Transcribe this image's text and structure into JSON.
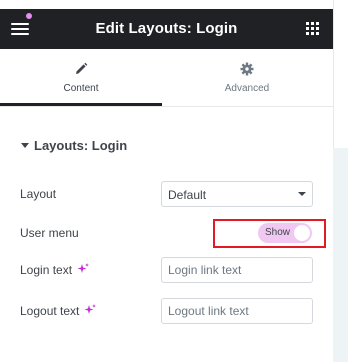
{
  "header": {
    "title": "Edit Layouts: Login"
  },
  "tabs": [
    {
      "label": "Content",
      "icon": "pencil-icon",
      "active": true
    },
    {
      "label": "Advanced",
      "icon": "gear-icon",
      "active": false
    }
  ],
  "section": {
    "title": "Layouts: Login"
  },
  "fields": {
    "layout": {
      "label": "Layout",
      "value": "Default"
    },
    "user_menu": {
      "label": "User menu",
      "toggle_label": "Show",
      "on": true
    },
    "login_text": {
      "label": "Login text",
      "placeholder": "Login link text"
    },
    "logout_text": {
      "label": "Logout text",
      "placeholder": "Logout link text"
    }
  },
  "colors": {
    "header_bg": "#1f2124",
    "toggle_bg": "#f1c8f1",
    "ai_accent": "#c12bd0",
    "highlight": "#e01b24"
  }
}
